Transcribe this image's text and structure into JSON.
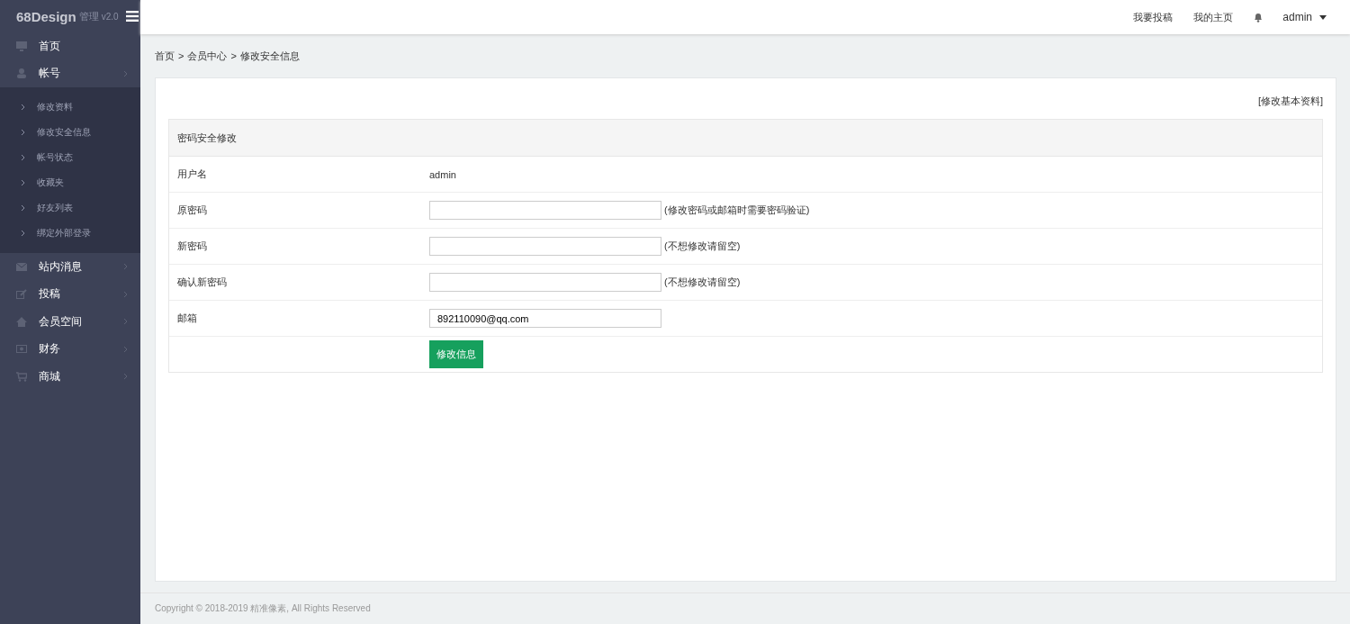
{
  "logo": {
    "name": "68Design",
    "suffix": "管理",
    "version": "v2.0"
  },
  "sidebar": {
    "items": [
      {
        "label": "首页"
      },
      {
        "label": "帐号",
        "expanded": true,
        "children": [
          {
            "label": "修改资料"
          },
          {
            "label": "修改安全信息"
          },
          {
            "label": "帐号状态"
          },
          {
            "label": "收藏夹"
          },
          {
            "label": "好友列表"
          },
          {
            "label": "绑定外部登录"
          }
        ]
      },
      {
        "label": "站内消息"
      },
      {
        "label": "投稿"
      },
      {
        "label": "会员空间"
      },
      {
        "label": "财务"
      },
      {
        "label": "商城"
      }
    ]
  },
  "topbar": {
    "links": [
      "我要投稿",
      "我的主页"
    ],
    "user": "admin"
  },
  "breadcrumb": {
    "separator": ">",
    "items": [
      "首页",
      "会员中心",
      "修改安全信息"
    ]
  },
  "panel": {
    "top_link": "[修改基本资料]",
    "title": "密码安全修改",
    "rows": [
      {
        "kind": "text",
        "label": "用户名",
        "value": "admin"
      },
      {
        "kind": "input",
        "label": "原密码",
        "value": "",
        "hint": "(修改密码或邮箱时需要密码验证)"
      },
      {
        "kind": "input",
        "label": "新密码",
        "value": "",
        "hint": "(不想修改请留空)"
      },
      {
        "kind": "input",
        "label": "确认新密码",
        "value": "",
        "hint": "(不想修改请留空)"
      },
      {
        "kind": "input",
        "label": "邮箱",
        "value": "892110090@qq.com"
      },
      {
        "kind": "button",
        "value": "修改信息"
      }
    ]
  },
  "footer": "Copyright © 2018-2019 精准像素, All Rights Reserved"
}
